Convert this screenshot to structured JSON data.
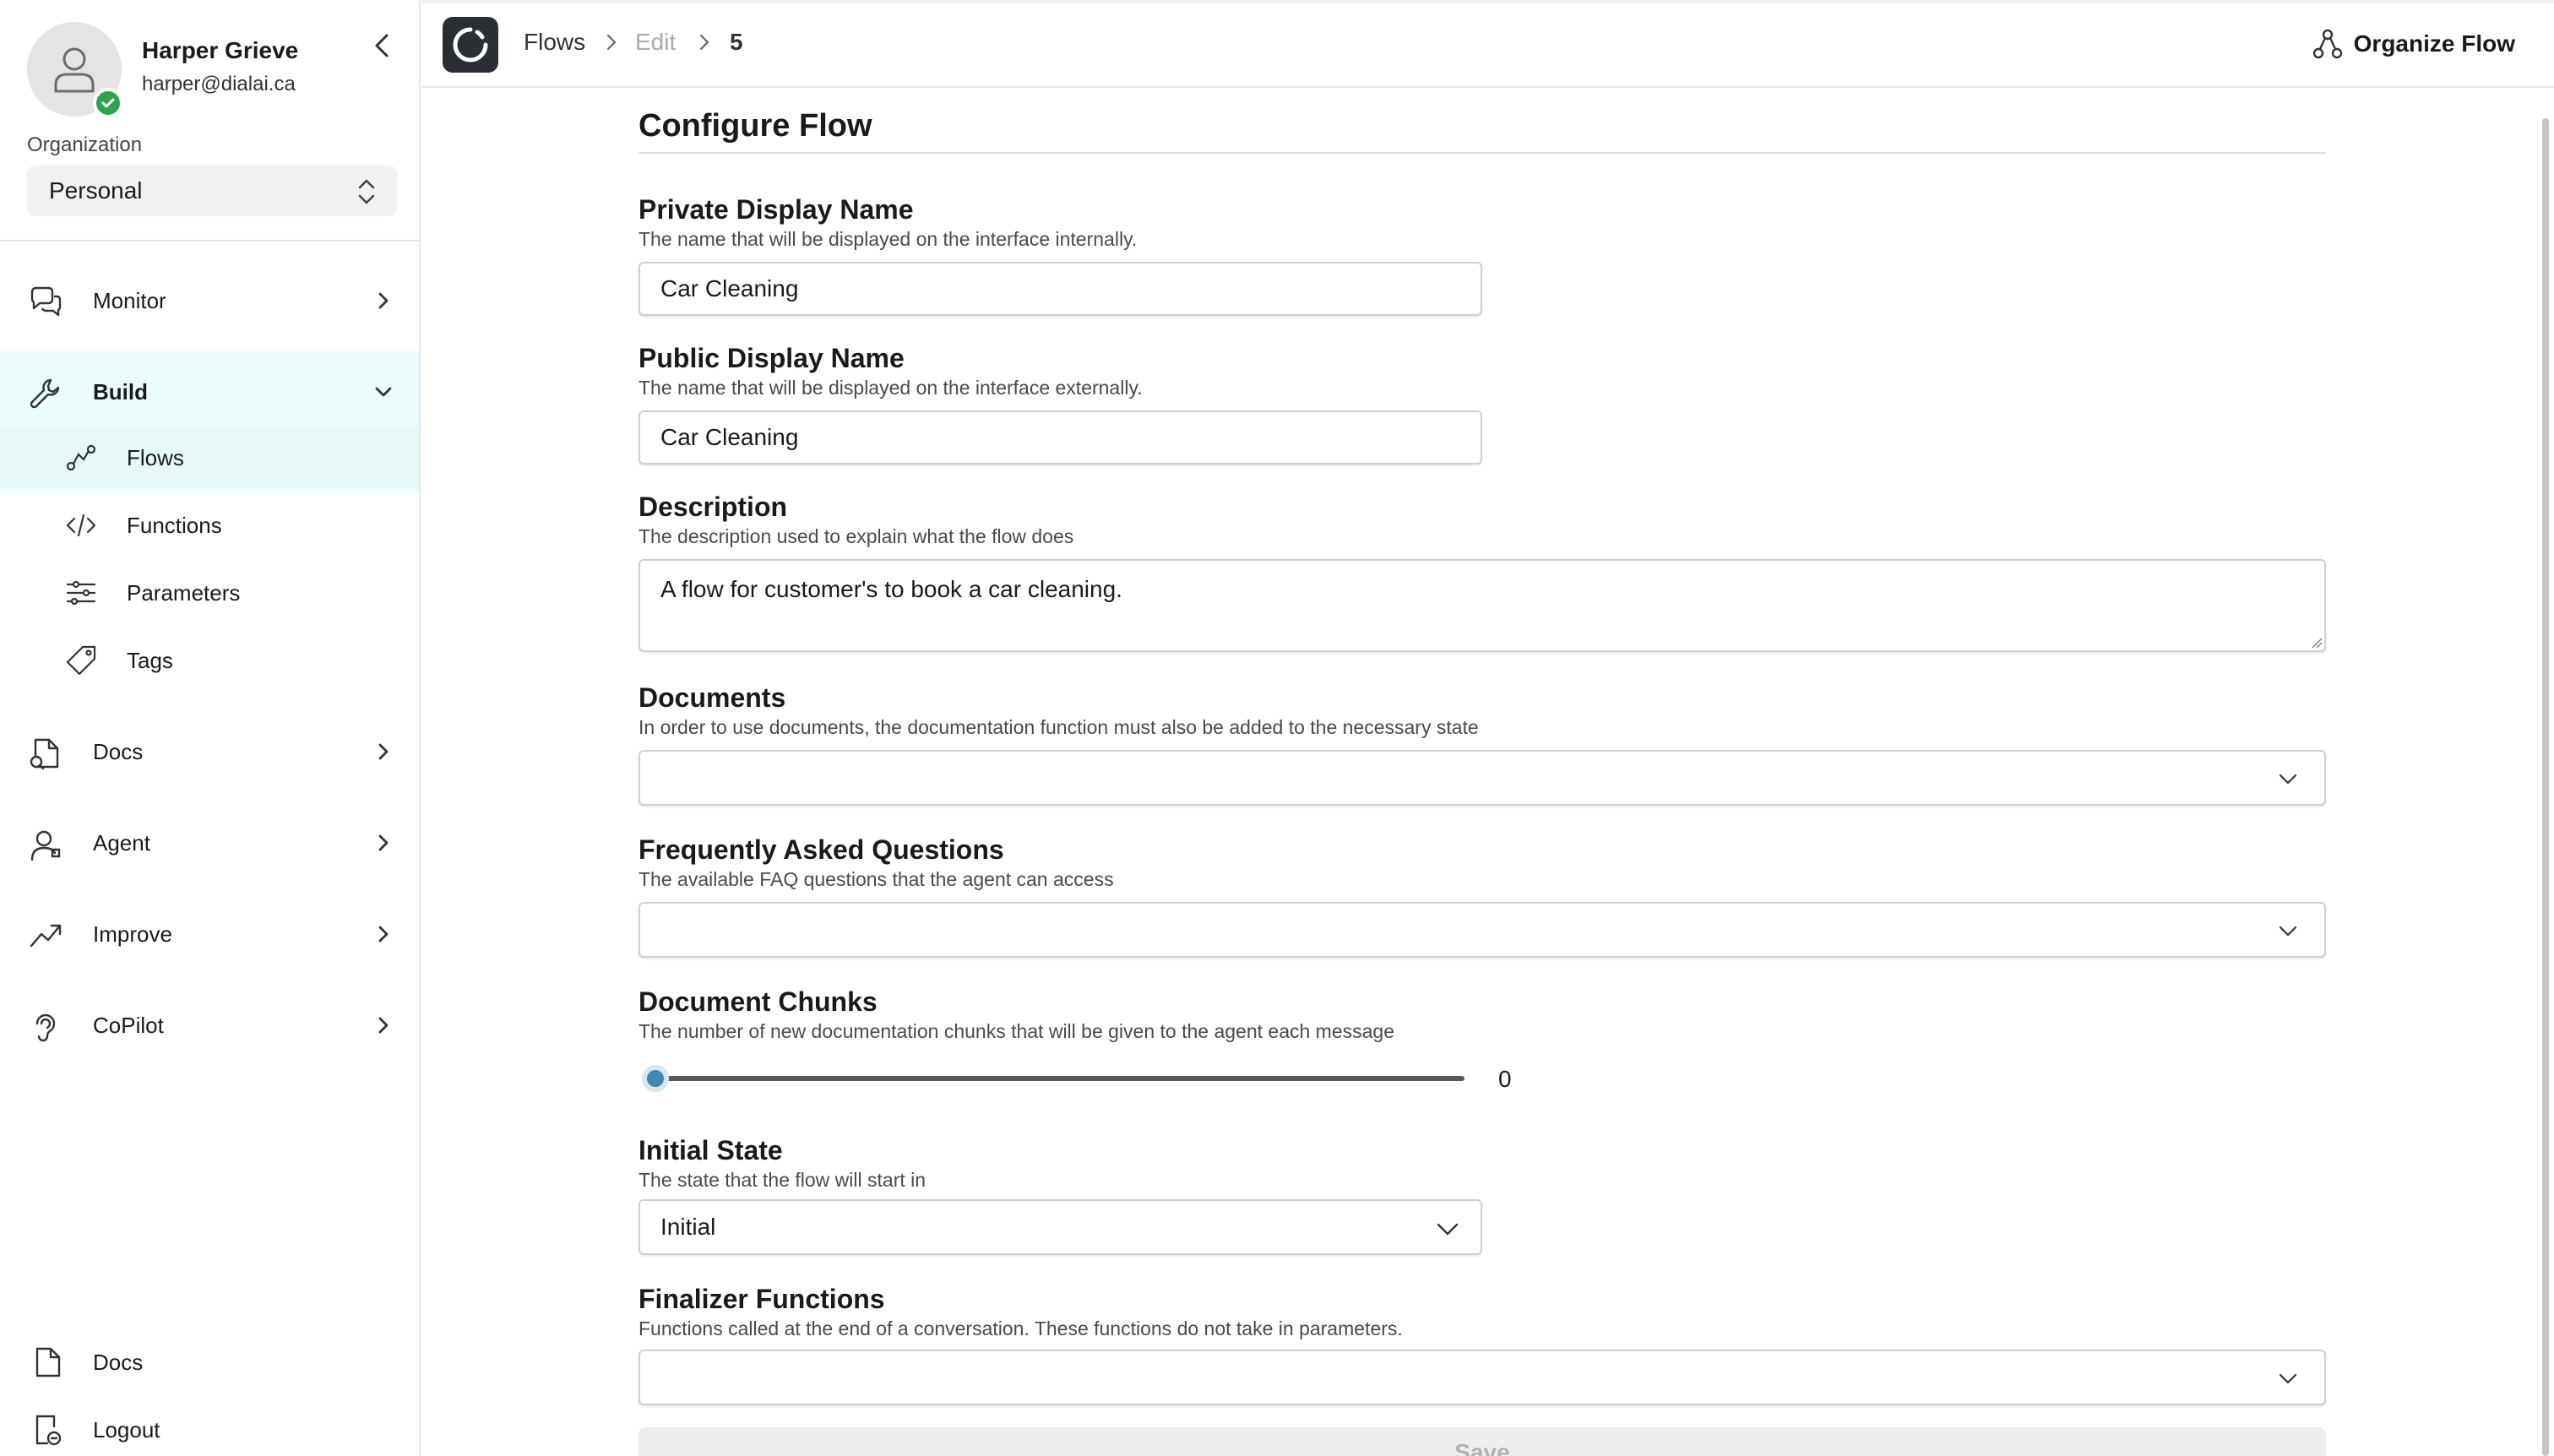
{
  "user": {
    "name": "Harper Grieve",
    "email": "harper@dialai.ca"
  },
  "organization": {
    "label": "Organization",
    "selected": "Personal"
  },
  "sidebar": {
    "items": [
      {
        "label": "Monitor",
        "icon": "chat-bubbles-icon"
      },
      {
        "label": "Build",
        "icon": "wrench-icon",
        "expanded": true
      },
      {
        "label": "Docs",
        "icon": "document-search-icon"
      },
      {
        "label": "Agent",
        "icon": "headset-agent-icon"
      },
      {
        "label": "Improve",
        "icon": "trending-up-icon"
      },
      {
        "label": "CoPilot",
        "icon": "copilot-ear-icon"
      }
    ],
    "build_sub": [
      {
        "label": "Flows",
        "icon": "flow-nodes-icon",
        "active": true
      },
      {
        "label": "Functions",
        "icon": "code-icon"
      },
      {
        "label": "Parameters",
        "icon": "sliders-icon"
      },
      {
        "label": "Tags",
        "icon": "tag-icon"
      }
    ],
    "bottom": [
      {
        "label": "Docs",
        "icon": "file-icon"
      },
      {
        "label": "Logout",
        "icon": "logout-icon"
      }
    ]
  },
  "header": {
    "breadcrumb": [
      "Flows",
      "Edit",
      "5"
    ],
    "organize_label": "Organize Flow"
  },
  "form": {
    "title": "Configure Flow",
    "private_name": {
      "label": "Private Display Name",
      "help": "The name that will be displayed on the interface internally.",
      "value": "Car Cleaning"
    },
    "public_name": {
      "label": "Public Display Name",
      "help": "The name that will be displayed on the interface externally.",
      "value": "Car Cleaning"
    },
    "description": {
      "label": "Description",
      "help": "The description used to explain what the flow does",
      "value": "A flow for customer's to book a car cleaning."
    },
    "documents": {
      "label": "Documents",
      "help": "In order to use documents, the documentation function must also be added to the necessary state",
      "value": ""
    },
    "faq": {
      "label": "Frequently Asked Questions",
      "help": "The available FAQ questions that the agent can access",
      "value": ""
    },
    "chunks": {
      "label": "Document Chunks",
      "help": "The number of new documentation chunks that will be given to the agent each message",
      "value": "0",
      "fraction": 0
    },
    "initial_state": {
      "label": "Initial State",
      "help": "The state that the flow will start in",
      "value": "Initial"
    },
    "finalizers": {
      "label": "Finalizer Functions",
      "help": "Functions called at the end of a conversation. These functions do not take in parameters.",
      "value": ""
    },
    "save_label": "Save"
  },
  "colors": {
    "accent": "#3f87b5",
    "active_bg": "#ecfbfb",
    "status_green": "#2ea44f"
  }
}
